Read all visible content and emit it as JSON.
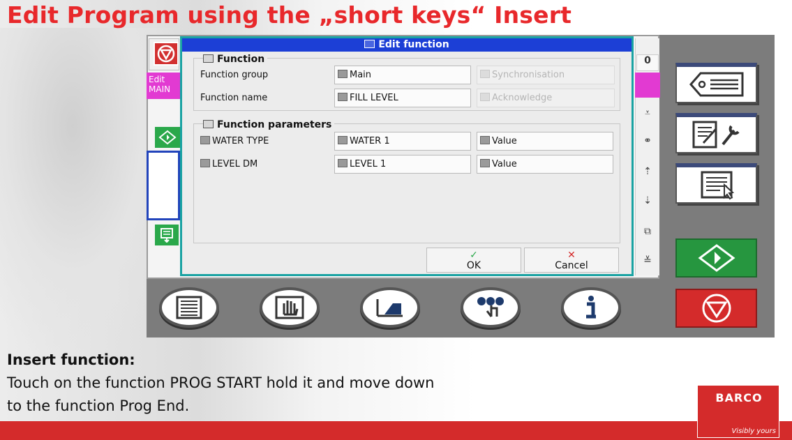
{
  "slide": {
    "title": "Edit Program using the „short keys“ Insert"
  },
  "hmi": {
    "edit_label": "Edit",
    "edit_sub": "MAIN",
    "counter_value": "0"
  },
  "dialog": {
    "title": "Edit function",
    "function_group_title": "Function",
    "function_group_label": "Function group",
    "function_group_value": "Main",
    "synchronisation": "Synchronisation",
    "function_name_label": "Function name",
    "function_name_value": "FILL LEVEL",
    "acknowledge": "Acknowledge",
    "params_title": "Function parameters",
    "params": [
      {
        "label": "WATER TYPE",
        "value": "WATER 1",
        "kind": "Value"
      },
      {
        "label": "LEVEL DM",
        "value": "LEVEL 1",
        "kind": "Value"
      }
    ],
    "ok_label": "OK",
    "cancel_label": "Cancel",
    "ok_color": "#2aa84a",
    "cancel_color": "#d42b2b"
  },
  "caption": {
    "heading": "Insert function:",
    "line1": "Touch on the function PROG START hold it and move down",
    "line2": "to the function Prog End."
  },
  "logo": {
    "name": "BARCO",
    "tagline": "Visibly yours"
  },
  "colors": {
    "title_red": "#e8282b",
    "dialog_title_blue": "#1c3fd6",
    "dialog_border_teal": "#1aa3a3",
    "magenta": "#e23ad2",
    "start_green": "#26963f",
    "stop_red": "#d42b2b"
  }
}
